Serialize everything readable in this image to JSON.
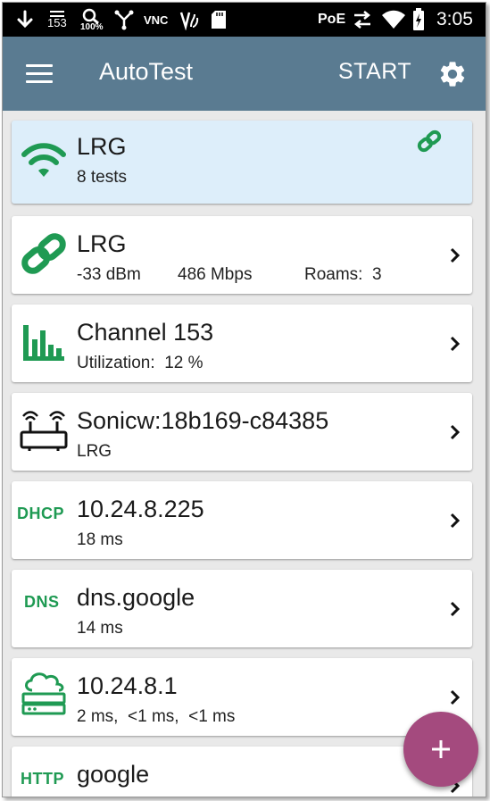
{
  "statusbar": {
    "channel_badge": "153",
    "signal_pct": "100%",
    "vnc": "VNC",
    "poe": "PoE",
    "time": "3:05"
  },
  "appbar": {
    "title": "AutoTest",
    "start_label": "START"
  },
  "cards": [
    {
      "icon": "wifi-icon",
      "title": "LRG",
      "subtitle": "8 tests",
      "accent_icon": "link-icon"
    },
    {
      "icon": "link-icon",
      "title": "LRG",
      "signal": "-33 dBm",
      "rate": "486 Mbps",
      "roams": "Roams:  3"
    },
    {
      "icon": "bar-chart-icon",
      "title": "Channel  153",
      "subtitle": "Utilization:  12 %"
    },
    {
      "icon": "access-point-icon",
      "title": "Sonicw:18b169-c84385",
      "subtitle": "LRG"
    },
    {
      "icon_text": "DHCP",
      "title": "10.24.8.225",
      "subtitle": "18 ms"
    },
    {
      "icon_text": "DNS",
      "title": "dns.google",
      "subtitle": "14 ms"
    },
    {
      "icon": "cloud-server-icon",
      "title": "10.24.8.1",
      "subtitle": "2 ms,  <1 ms,  <1 ms"
    },
    {
      "icon_text": "HTTP",
      "title": "google"
    }
  ],
  "colors": {
    "appbar": "#5a7b91",
    "accent_green": "#1f9a53",
    "profile_card_bg": "#ddeefa",
    "fab": "#a44a7e"
  }
}
